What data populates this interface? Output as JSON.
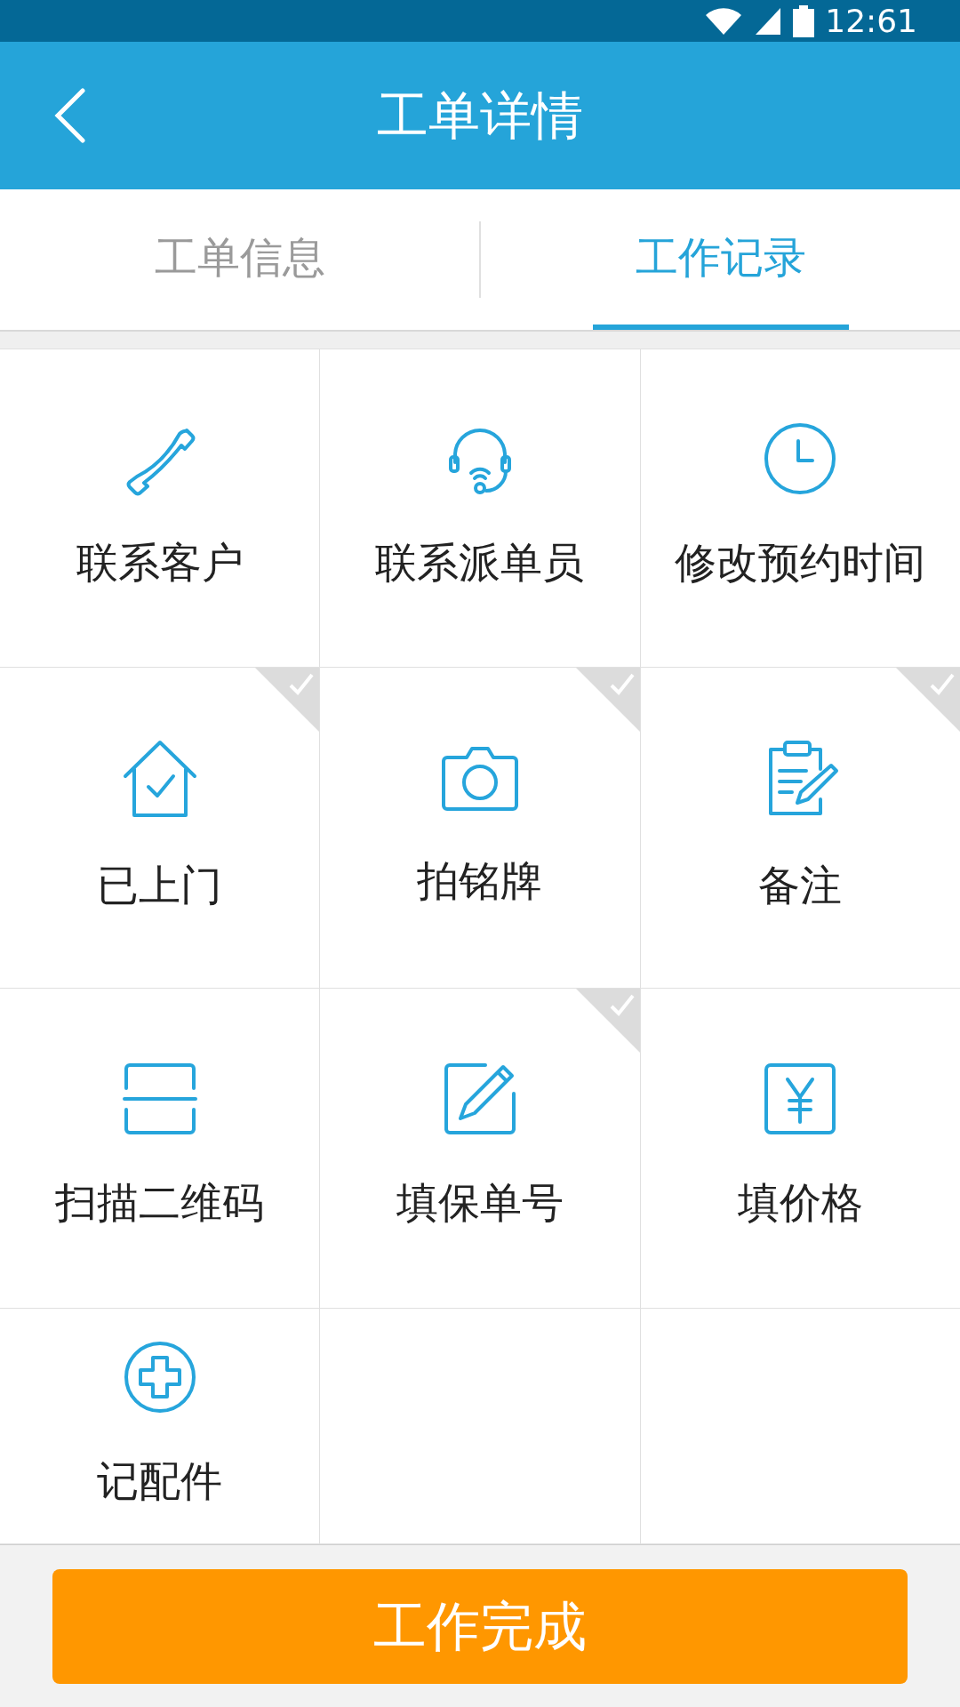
{
  "status_bar": {
    "time": "12:61"
  },
  "header": {
    "title": "工单详情"
  },
  "tabs": [
    {
      "label": "工单信息",
      "selected": false
    },
    {
      "label": "工作记录",
      "selected": true
    }
  ],
  "actions": [
    {
      "kind": "phone",
      "label": "联系客户",
      "done": false
    },
    {
      "kind": "headset",
      "label": "联系派单员",
      "done": false
    },
    {
      "kind": "clock",
      "label": "修改预约时间",
      "done": false
    },
    {
      "kind": "house",
      "label": "已上门",
      "done": true
    },
    {
      "kind": "camera",
      "label": "拍铭牌",
      "done": true
    },
    {
      "kind": "note",
      "label": "备注",
      "done": true
    },
    {
      "kind": "scan",
      "label": "扫描二维码",
      "done": false
    },
    {
      "kind": "edit",
      "label": "填保单号",
      "done": true
    },
    {
      "kind": "price",
      "label": "填价格",
      "done": false
    },
    {
      "kind": "parts",
      "label": "记配件",
      "done": false
    }
  ],
  "complete_button": {
    "label": "工作完成"
  }
}
